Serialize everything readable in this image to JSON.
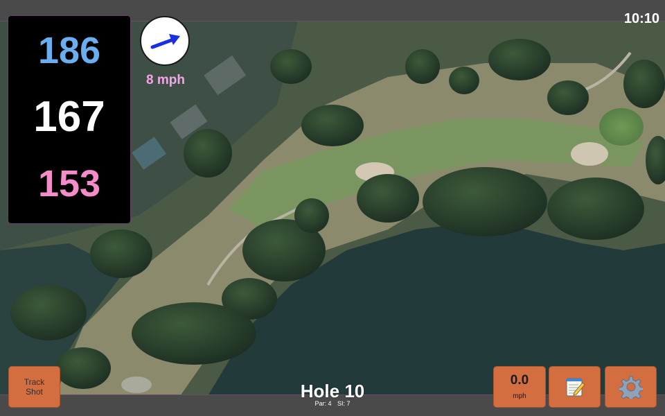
{
  "status": {
    "time": "10:10"
  },
  "distances": {
    "back": "186",
    "center": "167",
    "front": "153"
  },
  "wind": {
    "speed_label": "8 mph",
    "direction_icon": "wind-arrow-icon",
    "arrow_color": "#1a2fe0"
  },
  "hole": {
    "title": "Hole 10",
    "par": "Par: 4",
    "stroke_index": "SI: 7"
  },
  "buttons": {
    "track_shot": "Track Shot",
    "speed_value": "0.0",
    "speed_unit": "mph",
    "notes_icon": "notepad-icon",
    "settings_icon": "gear-icon"
  },
  "colors": {
    "back_distance": "#6aaef0",
    "center_distance": "#ffffff",
    "front_distance": "#f38cc8",
    "button": "#d26e3f",
    "wind_label": "#f2a6e6"
  }
}
